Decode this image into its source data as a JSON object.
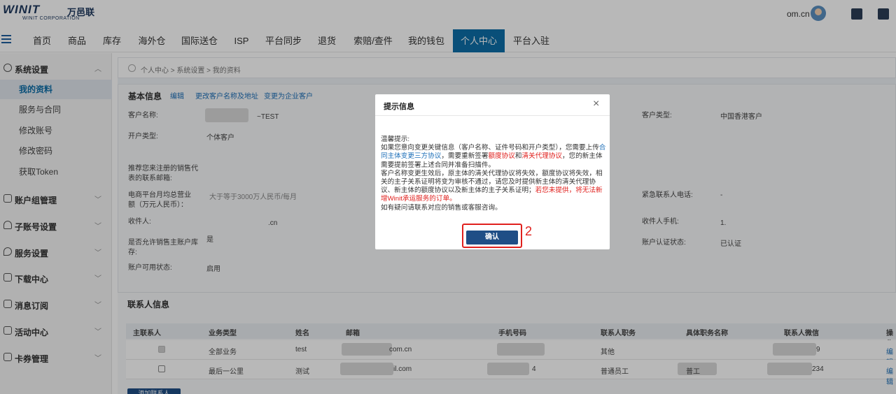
{
  "header": {
    "logo_main": "WINIT",
    "logo_cn": "万邑联",
    "logo_sub": "WINIT CORPORATION",
    "user_email": "om.cn"
  },
  "nav": {
    "items": [
      "首页",
      "商品",
      "库存",
      "海外仓",
      "国际送仓",
      "ISP",
      "平台同步",
      "退货",
      "索赔/查件",
      "我的钱包",
      "个人中心",
      "平台入驻"
    ],
    "active": "个人中心"
  },
  "sidebar": {
    "groups": [
      {
        "label": "系统设置",
        "icon": "gear-icon",
        "expanded": true,
        "items": [
          "我的资料",
          "服务与合同",
          "修改账号",
          "修改密码",
          "获取Token"
        ]
      },
      {
        "label": "账户组管理",
        "icon": "house-icon"
      },
      {
        "label": "子账号设置",
        "icon": "user-icon"
      },
      {
        "label": "服务设置",
        "icon": "heart-icon"
      },
      {
        "label": "下载中心",
        "icon": "house-icon"
      },
      {
        "label": "消息订阅",
        "icon": "flag-icon"
      },
      {
        "label": "活动中心",
        "icon": "list-icon"
      },
      {
        "label": "卡券管理",
        "icon": "ticket-icon"
      }
    ]
  },
  "breadcrumb": "个人中心 > 系统设置 > 我的资料",
  "basic_info": {
    "title": "基本信息",
    "links": [
      "编辑",
      "更改客户名称及地址",
      "变更为企业客户"
    ],
    "fields": {
      "customer_name_label": "客户名称:",
      "customer_name_value": "~TEST",
      "account_type_label": "开户类型:",
      "account_type_value": "个体客户",
      "sales_email_label": "推荐您来注册的销售代表的联系邮箱:",
      "revenue_label": "电商平台月均总营业额（万元人民币）：",
      "revenue_value": "大于等于3000万人民币/每月",
      "receiver_label": "收件人:",
      "receiver_value": ".cn",
      "allow_sell_label": "是否允许销售主账户库存:",
      "allow_sell_value": "是",
      "account_status_label": "账户可用状态:",
      "account_status_value": "启用",
      "customer_type_label": "客户类型:",
      "customer_type_value": "中国香港客户",
      "emergency_phone_label": "紧急联系人电话:",
      "emergency_phone_value": "-",
      "receiver_phone_label": "收件人手机:",
      "receiver_phone_value": "1.",
      "auth_status_label": "账户认证状态:",
      "auth_status_value": "已认证"
    }
  },
  "contacts": {
    "title": "联系人信息",
    "columns": [
      "主联系人",
      "业务类型",
      "姓名",
      "邮箱",
      "手机号码",
      "联系人职务",
      "具体职务名称",
      "联系人微信",
      "操作"
    ],
    "rows": [
      {
        "primary": true,
        "business": "全部业务",
        "name": "test",
        "email": "com.cn",
        "phone": "",
        "role": "其他",
        "title": "",
        "wechat": "9",
        "op": "编辑"
      },
      {
        "primary": false,
        "business": "最后一公里",
        "name": "测试",
        "email": "il.com",
        "phone": "4",
        "role": "普通员工",
        "title": "普工",
        "wechat": "234",
        "op": "编辑"
      }
    ],
    "add_button": "添加联系人"
  },
  "modal": {
    "title": "提示信息",
    "close": "×",
    "p1": "温馨提示:",
    "p2_a": "如果您意向变更关键信息（客户名称、证件号码和开户类型），您需要上传",
    "p2_link": "合同主体变更三方协议",
    "p2_b": "，需要重新签署",
    "p2_red1": "额度协议",
    "p2_c": "和",
    "p2_red2": "清关代理协议",
    "p2_d": "，您的新主体需要提前签署上述合同并准备扫描件。",
    "p3_a": "客户名称变更生效后，原主体的清关代理协议将失效，额度协议将失效，相关的主子关系证明将变为审核不通过，请您及时提供新主体的清关代理协议、新主体的额度协议以及新主体的主子关系证明；",
    "p3_red": "若您未提供，将无法新增Winit承运服务的订单。",
    "p4": "如有疑问请联系对应的销售或客服咨询。",
    "confirm": "确认",
    "annotation": "2"
  }
}
